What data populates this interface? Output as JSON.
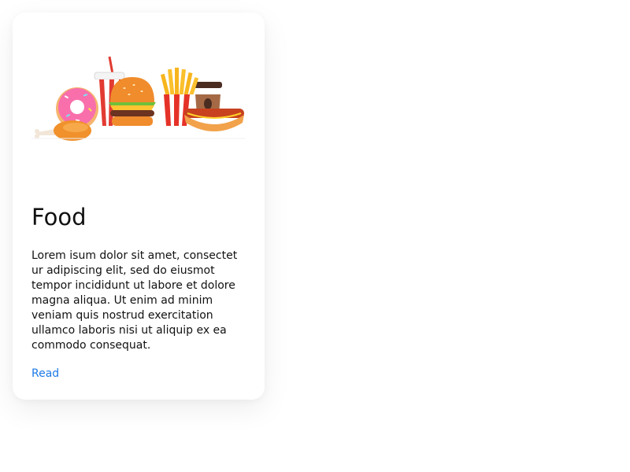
{
  "card": {
    "title": "Food",
    "body": "Lorem isum dolor sit amet, consectet ur adipiscing elit, sed do eiusmot tempor incididunt ut labore et dolore magna aliqua. Ut enim ad minim veniam quis nostrud exercitation ullamco laboris nisi ut aliquip ex ea commodo consequat.",
    "link_label": "Read",
    "link_color": "#1e7ae6",
    "image_icons": [
      "chicken-leg-icon",
      "donut-icon",
      "soda-cup-icon",
      "burger-icon",
      "fries-icon",
      "coffee-cup-icon",
      "hotdog-icon"
    ]
  }
}
